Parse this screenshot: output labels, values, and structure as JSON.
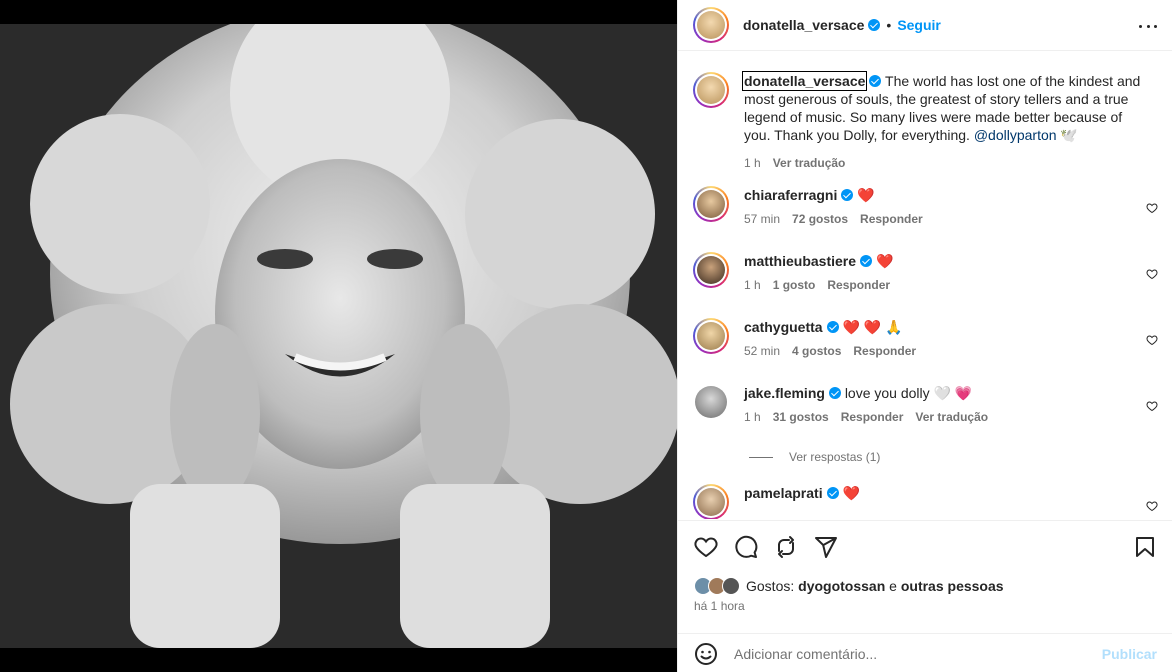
{
  "post": {
    "author": "donatella_versace",
    "follow_label": "Seguir",
    "separator": "•"
  },
  "caption": {
    "username": "donatella_versace",
    "text": "The world has lost one of the kindest and most generous of souls, the greatest of story tellers and a true legend of music. So many lives were made better because of you. Thank you Dolly, for everything.",
    "mention": "@dollyparton",
    "emoji": "🕊️",
    "time": "1 h",
    "translate": "Ver tradução"
  },
  "comments": [
    {
      "username": "chiaraferragni",
      "text": "",
      "emoji": "❤️",
      "time": "57 min",
      "likes": "72 gostos",
      "reply": "Responder"
    },
    {
      "username": "matthieubastiere",
      "text": "",
      "emoji": "❤️",
      "time": "1 h",
      "likes": "1 gosto",
      "reply": "Responder"
    },
    {
      "username": "cathyguetta",
      "text": "",
      "emoji": "❤️ ❤️ 🙏",
      "time": "52 min",
      "likes": "4 gostos",
      "reply": "Responder"
    },
    {
      "username": "jake.fleming",
      "text": "love you dolly",
      "emoji": "🤍 💗",
      "time": "1 h",
      "likes": "31 gostos",
      "reply": "Responder",
      "translate": "Ver tradução"
    },
    {
      "username": "pamelaprati",
      "text": "",
      "emoji": "❤️",
      "time": "",
      "likes": "",
      "reply": ""
    }
  ],
  "view_replies": "Ver respostas (1)",
  "likes_bar": {
    "prefix": "Gostos:",
    "user": "dyogotossan",
    "conj": "e",
    "others": "outras pessoas"
  },
  "time_ago": "há 1 hora",
  "add_comment": {
    "placeholder": "Adicionar comentário...",
    "publish": "Publicar"
  },
  "colors": {
    "accent": "#0095f6",
    "publish_disabled": "#b2dffc",
    "heart": "#e91e63"
  }
}
